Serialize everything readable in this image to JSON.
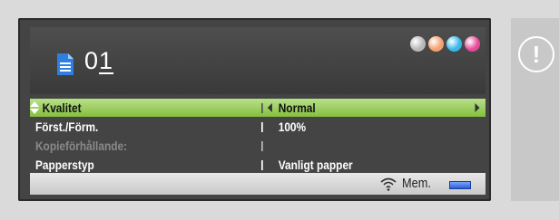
{
  "header": {
    "copies_prefix": "0",
    "copies_value": "1"
  },
  "ink": [
    {
      "name": "black",
      "color": "#b8b8b8"
    },
    {
      "name": "yellow",
      "color": "#f4a070"
    },
    {
      "name": "cyan",
      "color": "#36b8e8"
    },
    {
      "name": "magenta",
      "color": "#e84a9a"
    }
  ],
  "settings": {
    "rows": [
      {
        "label": "Kvalitet",
        "value": "Normal"
      },
      {
        "label": "Först./Förm.",
        "value": "100%"
      },
      {
        "label": "Kopieförhållande:",
        "value": ""
      },
      {
        "label": "Papperstyp",
        "value": "Vanligt papper"
      }
    ]
  },
  "status": {
    "memory_label": "Mem."
  },
  "alert": {
    "symbol": "!"
  }
}
